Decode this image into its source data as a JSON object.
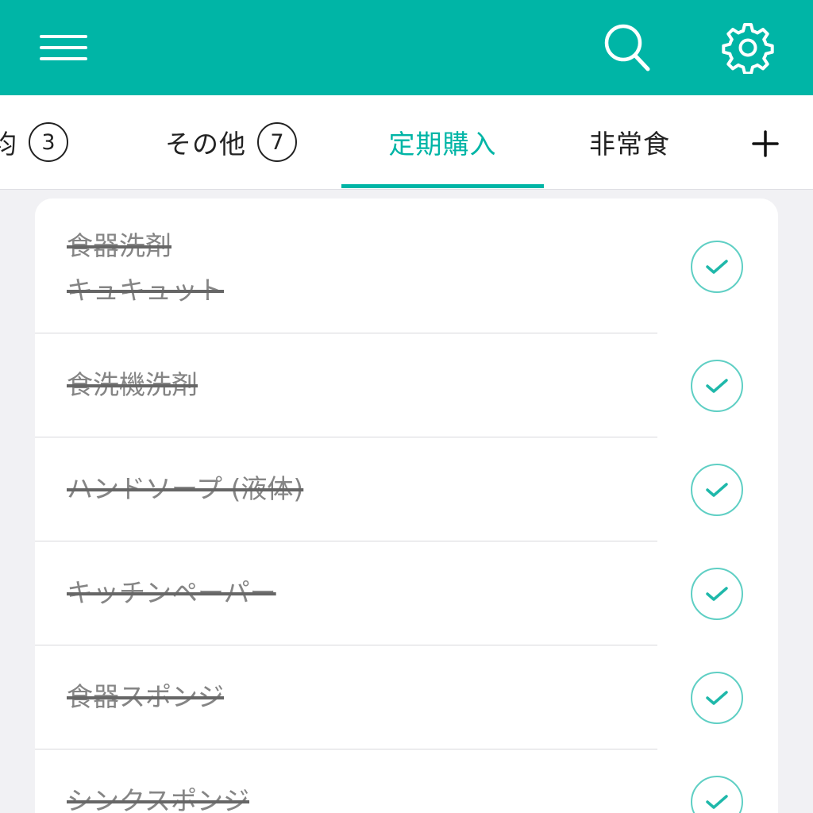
{
  "colors": {
    "accent": "#00b5a6",
    "header_bg": "#00b5a6",
    "done_text": "#858585",
    "check_ring": "#5fcfc4"
  },
  "header": {
    "menu_icon": "hamburger-menu-icon",
    "search_icon": "search-icon",
    "settings_icon": "gear-icon"
  },
  "tabs": [
    {
      "label": "均",
      "badge": "3",
      "active": false
    },
    {
      "label": "その他",
      "badge": "7",
      "active": false
    },
    {
      "label": "定期購入",
      "badge": "",
      "active": true
    },
    {
      "label": "非常食",
      "badge": "",
      "active": false
    }
  ],
  "add_tab_icon": "plus-icon",
  "items": [
    {
      "name": "食器洗剤\nキュキュット",
      "done": true
    },
    {
      "name": "食洗機洗剤",
      "done": true
    },
    {
      "name": "ハンドソープ (液体)",
      "done": true
    },
    {
      "name": "キッチンペーパー",
      "done": true
    },
    {
      "name": "食器スポンジ",
      "done": true
    },
    {
      "name": "シンクスポンジ",
      "done": true
    }
  ],
  "check_icon": "check-circle-icon"
}
